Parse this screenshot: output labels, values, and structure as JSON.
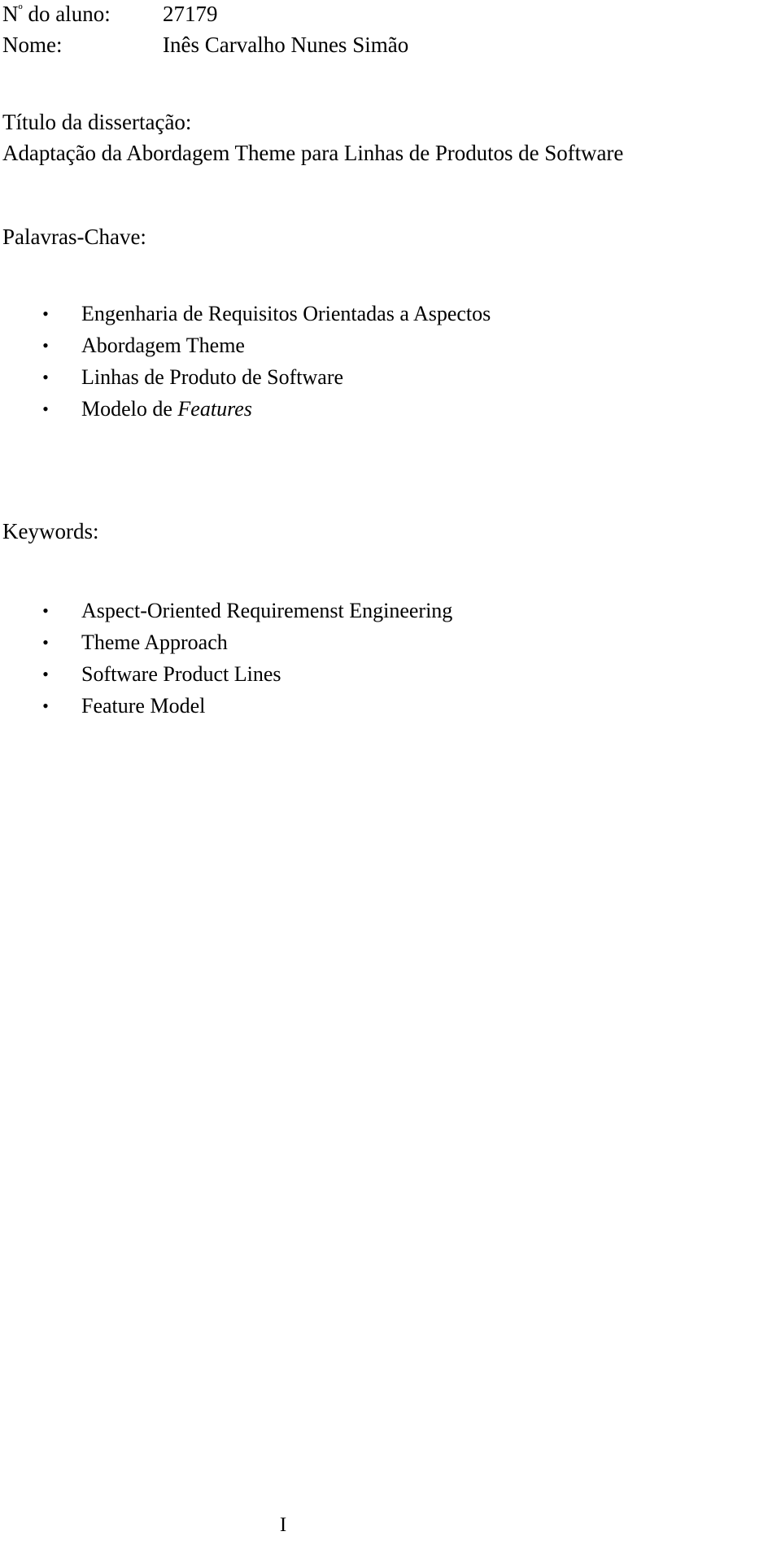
{
  "document": {
    "page_number": "I",
    "bullet_glyph": "•"
  },
  "header": {
    "student_number": {
      "label_prefix": "N",
      "label_ordinal": "º",
      "label_suffix": " do aluno:",
      "value": "27179"
    },
    "student_name": {
      "label": "Nome:",
      "value": "Inês Carvalho Nunes Simão"
    }
  },
  "title_section": {
    "label": "Título da dissertação:",
    "title": "Adaptação da Abordagem Theme para Linhas de Produtos de Software"
  },
  "keywords_pt": {
    "label": "Palavras-Chave:",
    "items": [
      {
        "text": "Engenharia de Requisitos Orientadas a Aspectos",
        "emphasis": ""
      },
      {
        "text": "Abordagem Theme",
        "emphasis": ""
      },
      {
        "text": "Linhas de Produto de Software",
        "emphasis": ""
      },
      {
        "text": "Modelo de ",
        "emphasis": "Features"
      }
    ]
  },
  "keywords_en": {
    "label": "Keywords:",
    "items": [
      {
        "text": "Aspect-Oriented Requiremenst Engineering",
        "emphasis": ""
      },
      {
        "text": "Theme Approach",
        "emphasis": ""
      },
      {
        "text": "Software Product Lines",
        "emphasis": ""
      },
      {
        "text": "Feature Model",
        "emphasis": ""
      }
    ]
  }
}
